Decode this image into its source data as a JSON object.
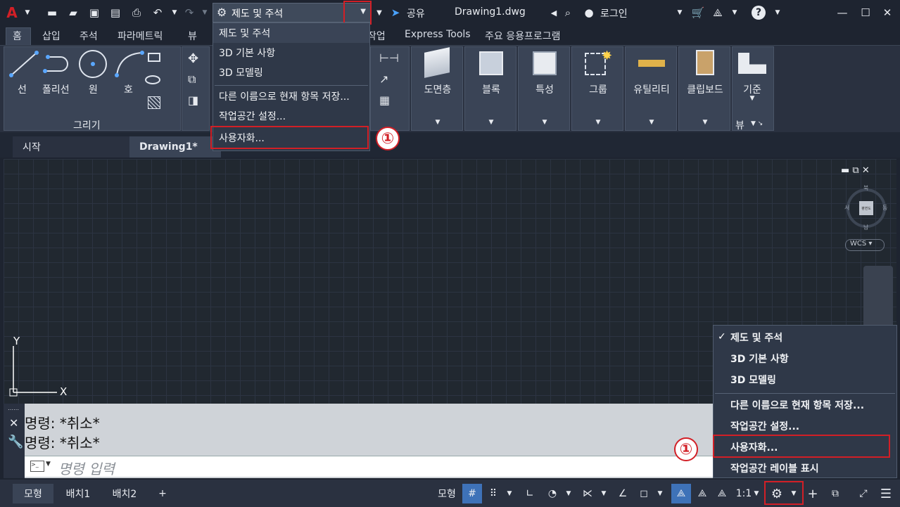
{
  "title_bar": {
    "workspace_selected": "제도 및 주석",
    "share_label": "공유",
    "doc_name": "Drawing1.dwg",
    "login_label": "로그인",
    "help_icon": "?"
  },
  "ribbon_tabs": [
    "홈",
    "삽입",
    "주석",
    "파라메트릭",
    "뷰",
    "작업",
    "Express Tools",
    "주요 응용프로그램"
  ],
  "ribbon": {
    "draw_tools": [
      "선",
      "폴리선",
      "원",
      "호"
    ],
    "draw_panel_label": "그리기",
    "panels": [
      "도면층",
      "블록",
      "특성",
      "그룹",
      "유틸리티",
      "클립보드",
      "기준"
    ],
    "view_label": "뷰"
  },
  "doc_tabs": [
    "시작",
    "Drawing1*"
  ],
  "top_menu": {
    "items": [
      "제도 및 주석",
      "3D 기본 사항",
      "3D 모델링",
      "다른 이름으로 현재 항목 저장...",
      "작업공간 설정...",
      "사용자화..."
    ]
  },
  "badge": "①",
  "viewcube": {
    "north": "북",
    "south": "남",
    "west": "서",
    "east": "동",
    "face": "평면도",
    "wcs": "WCS"
  },
  "ucs": {
    "y": "Y",
    "x": "X"
  },
  "command": {
    "history": [
      "명령:  *취소*",
      "명령:  *취소*"
    ],
    "placeholder": "명령 입력"
  },
  "status_menu": {
    "items": [
      "제도 및 주석",
      "3D 기본 사항",
      "3D 모델링",
      "다른 이름으로 현재 항목 저장...",
      "작업공간 설정...",
      "사용자화...",
      "작업공간 레이블 표시"
    ],
    "checked": "✓"
  },
  "status_bar": {
    "layout_tabs": [
      "모형",
      "배치1",
      "배치2"
    ],
    "model_button": "모형",
    "scale": "1:1"
  },
  "colors": {
    "accent_red": "#d21f26",
    "panel_bg": "#3a4456",
    "canvas_bg": "#212830"
  }
}
